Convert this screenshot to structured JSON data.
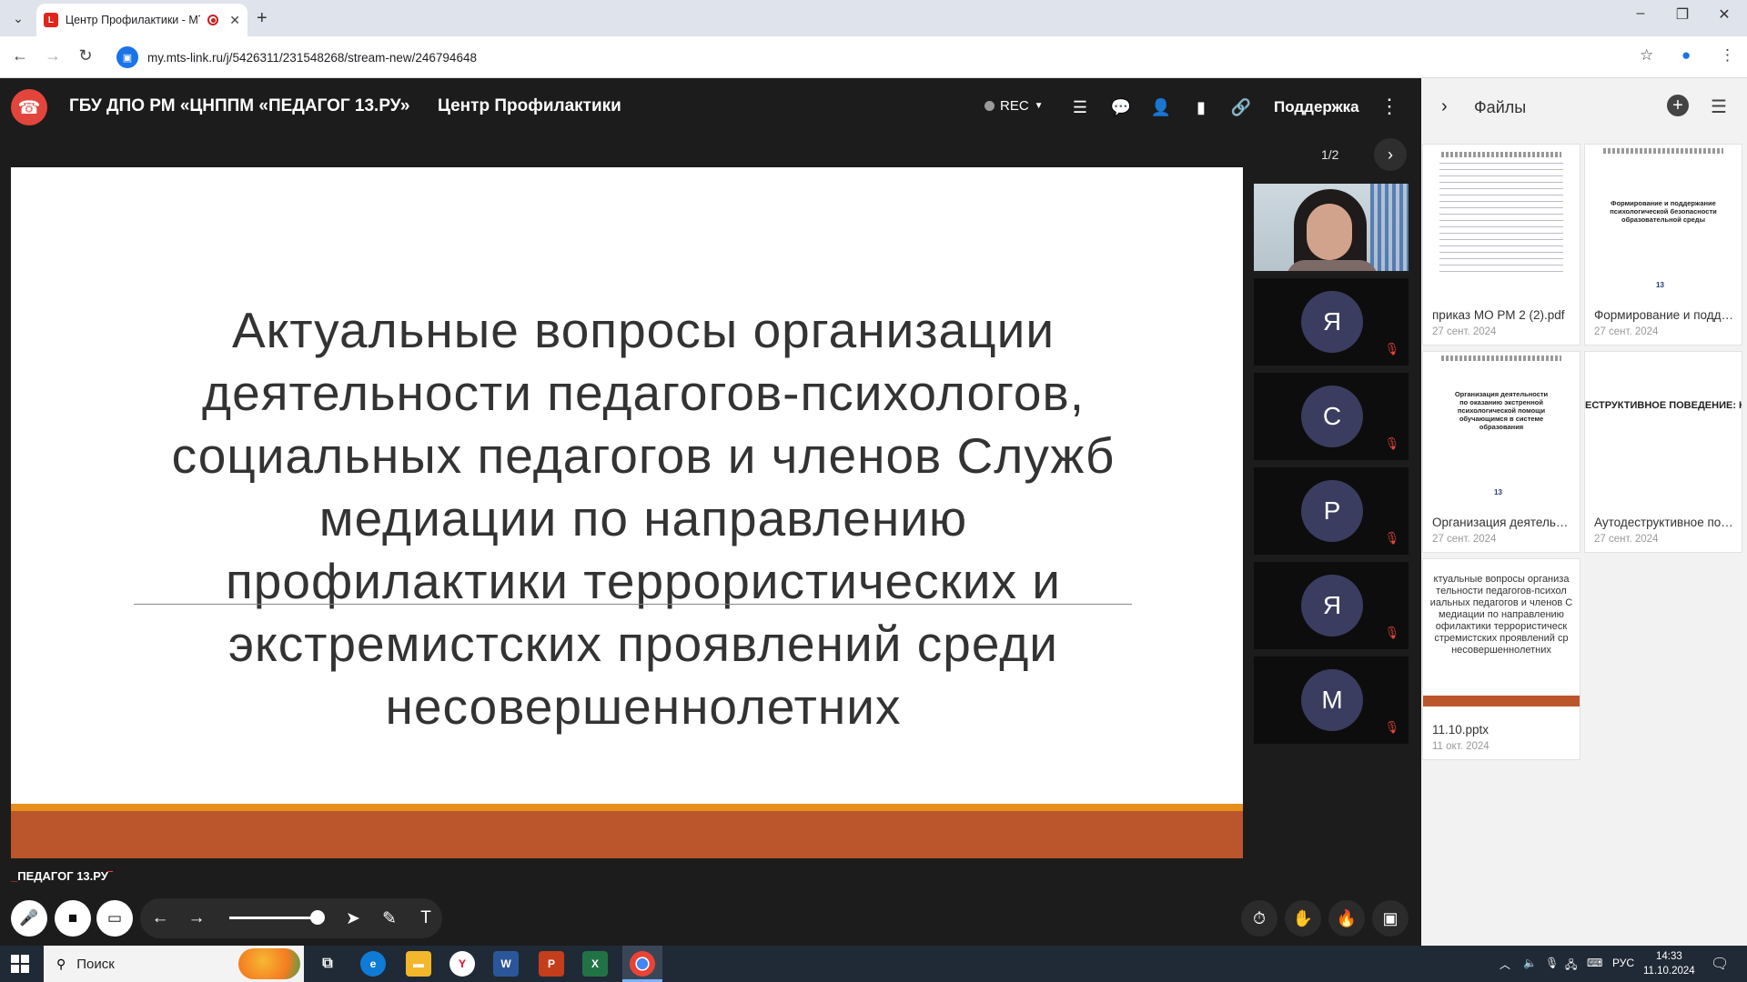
{
  "browser": {
    "tab_title": "Центр Профилактики - МТ",
    "url": "my.mts-link.ru/j/5426311/231548268/stream-new/246794648"
  },
  "webinar": {
    "org_name": "ГБУ ДПО РМ «ЦНППМ «ПЕДАГОГ 13.РУ»",
    "room_name": "Центр Профилактики",
    "rec_label": "REC",
    "support_label": "Поддержка",
    "page_indicator": "1/2",
    "brand_logo": "ПЕДАГОГ 13.РУ"
  },
  "slide": {
    "title": "Актуальные вопросы организации\nдеятельности педагогов-психологов,\nсоциальных педагогов и членов Служб\nмедиации по направлению\nпрофилактики террористических и\nэкстремистских проявлений среди\nнесовершеннолетних"
  },
  "participants": [
    {
      "type": "video"
    },
    {
      "initial": "Я",
      "muted": true
    },
    {
      "initial": "С",
      "muted": true
    },
    {
      "initial": "Р",
      "muted": true
    },
    {
      "initial": "Я",
      "muted": true
    },
    {
      "initial": "М",
      "muted": true
    }
  ],
  "files_panel": {
    "title": "Файлы",
    "files": [
      {
        "name": "приказ МО РМ 2 (2).pdf",
        "date": "27 сент. 2024"
      },
      {
        "name": "Формирование и поддержание психологической безопасности образовательной среды",
        "date": "27 сент. 2024",
        "thumb_text": "Формирование и поддержание психологической безопасности образовательной среды"
      },
      {
        "name": "Организация деятельности по оказанию экстренной психологической помощи",
        "date": "27 сент. 2024",
        "thumb_text": "Организация деятельности по оказанию экстренной психологической помощи обучающимся в системе образования"
      },
      {
        "name": "Аутодеструктивное поведение",
        "date": "27 сент. 2024",
        "thumb_text": "ЕСТРУКТИВНОЕ ПОВЕДЕНИЕ: НЫ, ПОСЛЕДСТВИЯ, ПОМОЩЬ"
      },
      {
        "name": "11.10.pptx",
        "date": "11 окт. 2024",
        "thumb_lines": [
          "ктуальные вопросы организа",
          "тельности педагогов-психол",
          "иальных педагогов и членов С",
          "медиации по направлению",
          "офилактики террористическ",
          "стремистских проявлений ср",
          "несовершеннолетних"
        ]
      }
    ]
  },
  "taskbar": {
    "search_label": "Поиск",
    "lang": "РУС",
    "time": "14:33",
    "date": "11.10.2024"
  },
  "colors": {
    "end_call": "#e1453c",
    "slide_band": "#bb552b",
    "slide_band_top": "#e78f1c",
    "avatar_bg": "#3a3d5f"
  }
}
